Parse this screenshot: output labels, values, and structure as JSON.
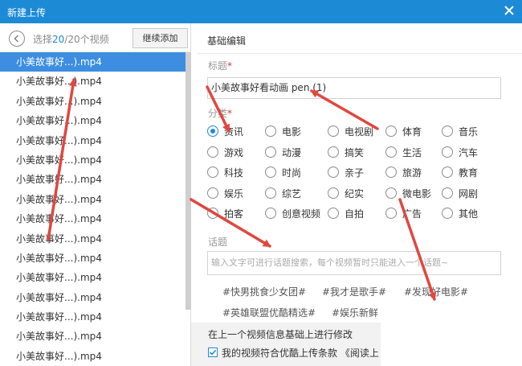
{
  "window": {
    "title": "新建上传",
    "close_icon": "close-icon"
  },
  "left": {
    "selection_prefix": "选择",
    "selection_count": "20",
    "selection_suffix": "/20个视频",
    "add_more_label": "继续添加",
    "files": [
      "小美故事好...).mp4",
      "小美故事好...).mp4",
      "小美故事好...).mp4",
      "小美故事好...).mp4",
      "小美故事好...).mp4",
      "小美故事好...).mp4",
      "小美故事好...).mp4",
      "小美故事好...).mp4",
      "小美故事好...).mp4",
      "小美故事好...).mp4",
      "小美故事好...).mp4",
      "小美故事好...).mp4",
      "小美故事好...).mp4",
      "小美故事好...).mp4",
      "小美故事好...).mp4",
      "小美故事好...).mp4"
    ],
    "active_index": 0
  },
  "right": {
    "section_title": "基础编辑",
    "title_label": "标题",
    "title_value": "小美故事好看动画 pen (1)",
    "category_label": "分类",
    "categories": [
      [
        "资讯",
        "电影",
        "电视剧",
        "体育",
        "音乐"
      ],
      [
        "游戏",
        "动漫",
        "搞笑",
        "生活",
        "汽车"
      ],
      [
        "科技",
        "时尚",
        "亲子",
        "旅游",
        "教育"
      ],
      [
        "娱乐",
        "综艺",
        "纪实",
        "微电影",
        "网剧"
      ],
      [
        "拍客",
        "创意视频",
        "自拍",
        "广告",
        "其他"
      ]
    ],
    "selected_category": "资讯",
    "topic_label": "话题",
    "topic_placeholder": "输入文字可进行话题搜索，每个视频暂时只能进入一个话题~",
    "topic_tags": [
      "#快男挑食少女团#",
      "#我才是歌手#",
      "#发现好电影#",
      "#英雄联盟优酷精选#",
      "#娱乐新鲜"
    ],
    "modify_text": "在上一个视频信息基础上进行修改",
    "agree_text": "我的视频符合优酷上传条款 《阅读上"
  },
  "colors": {
    "accent": "#1d8ad6",
    "active_row": "#3d8ee0",
    "arrow": "#e0473f",
    "required": "#e03636"
  }
}
